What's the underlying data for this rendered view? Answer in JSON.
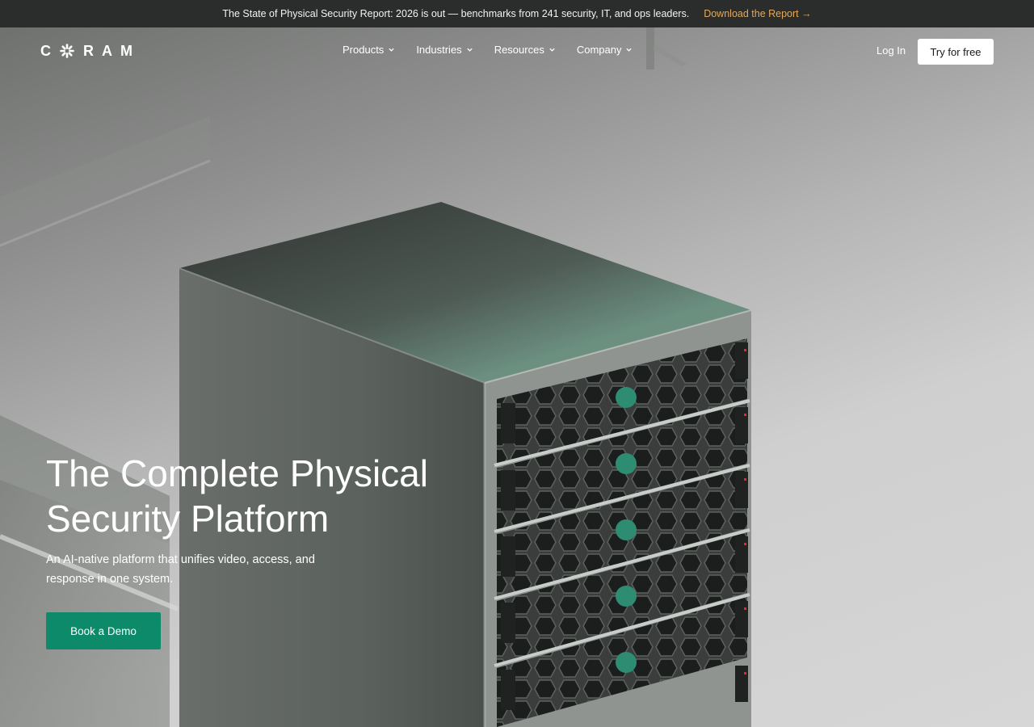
{
  "announcement": {
    "text": "The State of Physical Security Report: 2026 is out — benchmarks from 241 security, IT, and ops leaders.",
    "link_label": "Download the Report →"
  },
  "brand": {
    "name": "C  R A M",
    "logo_icon": "coram-burst-icon"
  },
  "nav": {
    "items": [
      {
        "label": "Products"
      },
      {
        "label": "Industries"
      },
      {
        "label": "Resources"
      },
      {
        "label": "Company"
      }
    ],
    "login_label": "Log In",
    "cta_label": "Try for free"
  },
  "hero": {
    "title": "The Complete Physical Security Platform",
    "subtitle": "An AI-native platform that unifies video, access, and response in one system.",
    "button_label": "Book a Demo"
  },
  "colors": {
    "accent": "#0d8a6a",
    "announce_link": "#e3a85c",
    "announce_bg": "#2b2d2c"
  }
}
